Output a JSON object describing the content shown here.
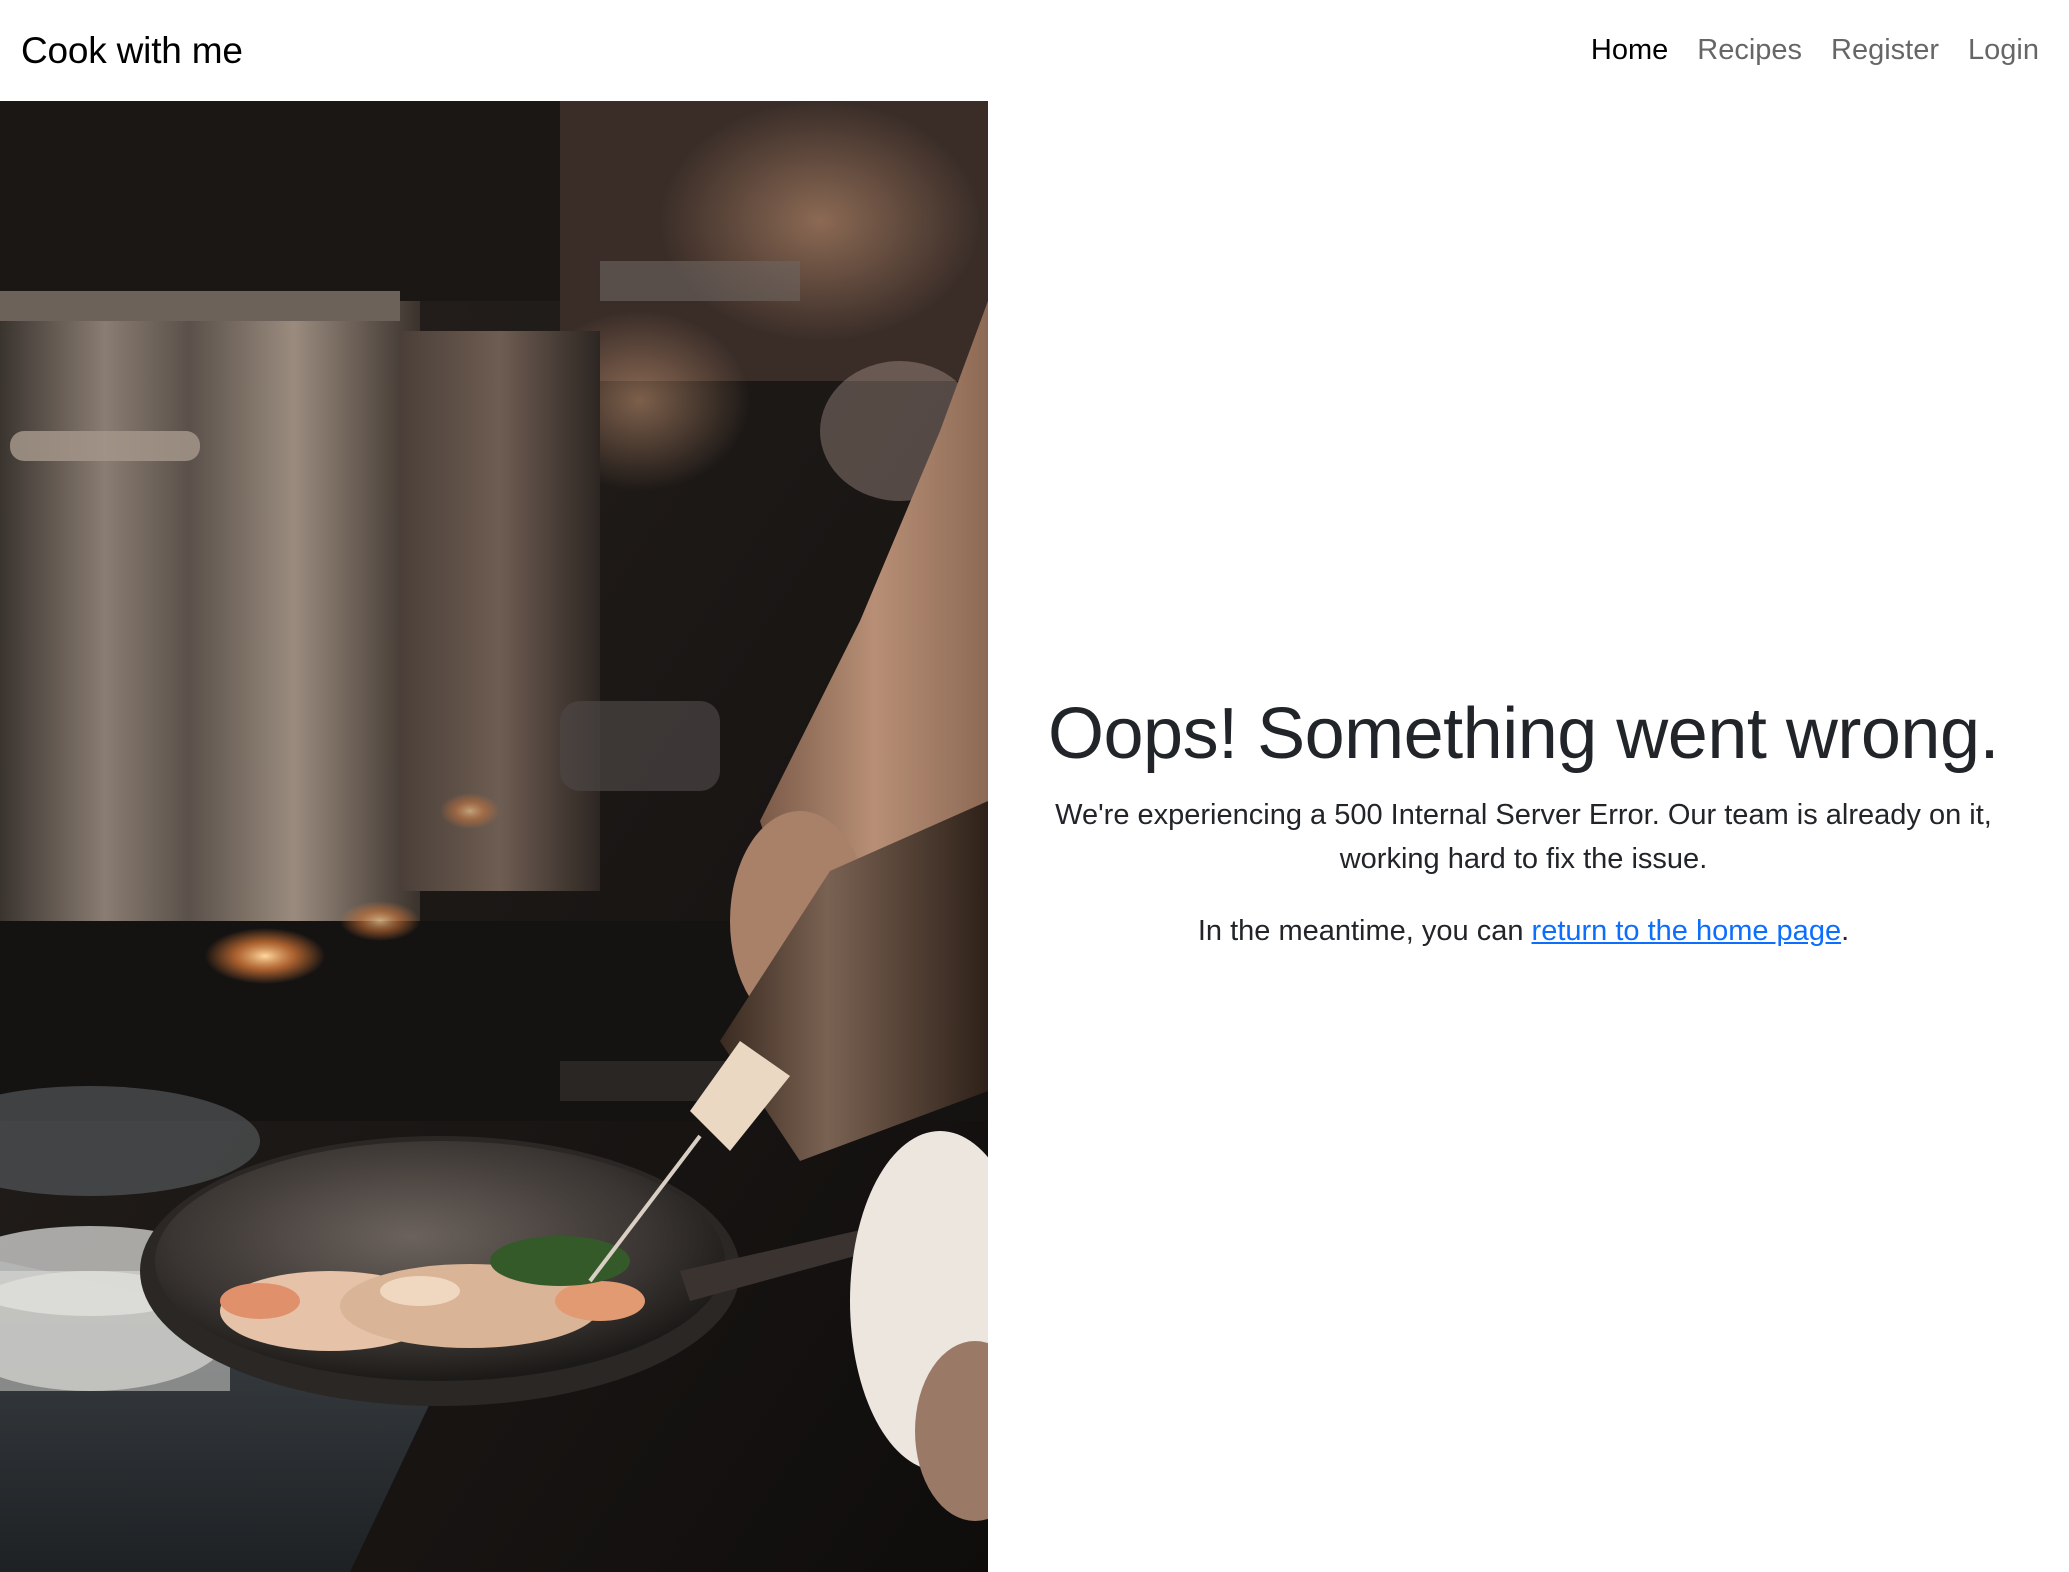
{
  "navbar": {
    "brand": "Cook with me",
    "links": [
      {
        "label": "Home",
        "active": true
      },
      {
        "label": "Recipes",
        "active": false
      },
      {
        "label": "Register",
        "active": false
      },
      {
        "label": "Login",
        "active": false
      }
    ]
  },
  "hero": {
    "image_description_icon": "kitchen-photo-image"
  },
  "error": {
    "title": "Oops! Something went wrong.",
    "message": "We're experiencing a 500 Internal Server Error. Our team is already on it, working hard to fix the issue.",
    "meantime_prefix": "In the meantime, you can ",
    "home_link": "return to the home page",
    "meantime_suffix": "."
  },
  "colors": {
    "link": "#0d6efd",
    "text": "#212529",
    "nav_inactive": "#737373"
  }
}
